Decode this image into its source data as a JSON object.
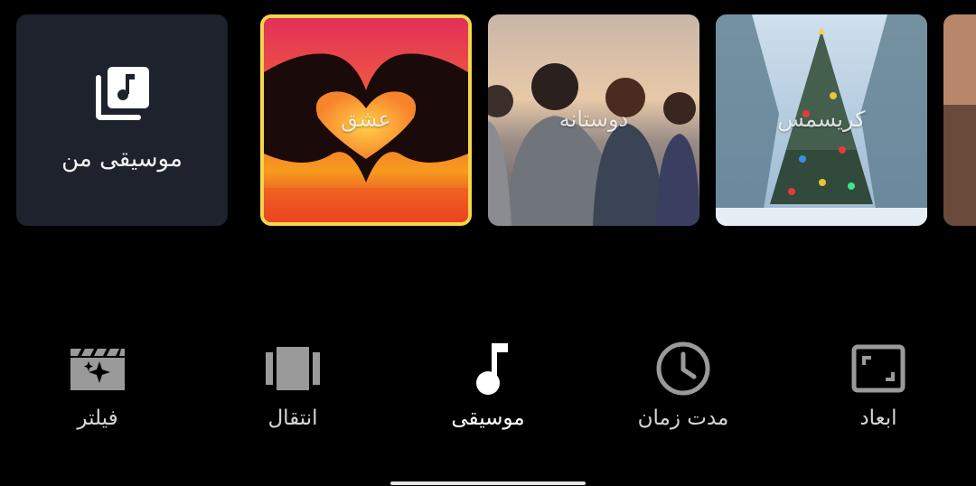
{
  "music_cards": [
    {
      "label": "موسیقی من",
      "icon": "music-library-icon"
    },
    {
      "label": "عشق",
      "selected": true,
      "accent": "#f6d64a"
    },
    {
      "label": "دوستانه"
    },
    {
      "label": "کریسمس"
    }
  ],
  "toolbar": [
    {
      "label": "فیلتر",
      "icon": "filter-clapperboard-icon"
    },
    {
      "label": "انتقال",
      "icon": "transition-icon"
    },
    {
      "label": "موسیقی",
      "icon": "music-note-icon",
      "active": true
    },
    {
      "label": "مدت زمان",
      "icon": "clock-icon"
    },
    {
      "label": "ابعاد",
      "icon": "aspect-ratio-icon"
    }
  ],
  "colors": {
    "background": "#000000",
    "card": "#1d222c",
    "selected_border": "#f6d64a",
    "inactive_icon": "#9a9a9a",
    "active_icon": "#ffffff"
  }
}
